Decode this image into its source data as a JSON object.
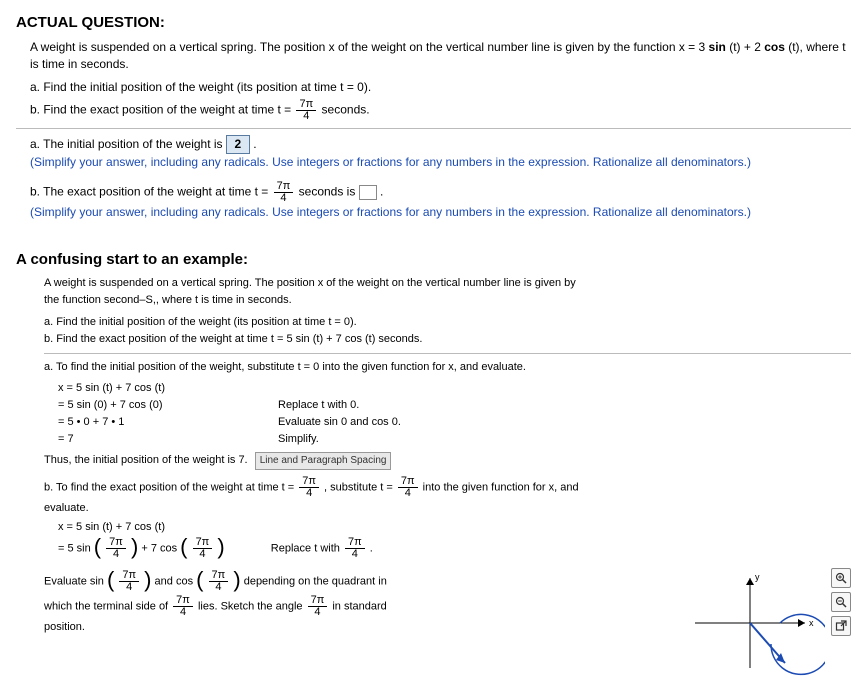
{
  "titles": {
    "actual": "ACTUAL QUESTION:",
    "example": "A confusing start to an example:"
  },
  "problem": {
    "statement_prefix": "A weight is suspended on a vertical spring. The position x of the weight on the vertical number line is given by the function x = 3 ",
    "func_sin": "sin",
    "func_cos": "cos",
    "statement_mid": " (t) + 2 ",
    "statement_suffix": " (t), where t is time in seconds.",
    "part_a": "a. Find the initial position of the weight (its position at time t = 0).",
    "part_b_prefix": "b. Find the exact position of the weight at time t = ",
    "part_b_suffix": " seconds.",
    "frac_num": "7π",
    "frac_den": "4"
  },
  "answers": {
    "a_prefix": "a. The initial position of the weight is ",
    "a_value": "2",
    "a_period": ".",
    "hint_text": "(Simplify your answer, including any radicals. Use integers or fractions for any numbers in the expression. Rationalize all denominators.)",
    "b_prefix": "b. The exact position of the weight at time t = ",
    "b_mid": " seconds is ",
    "b_period": "."
  },
  "example": {
    "statement1": "A weight is suspended on a vertical spring. The position x of the weight on the vertical number line is given by",
    "statement2": "the function second–S,, where t is time in seconds.",
    "part_a": "a. Find the initial position of the weight (its position at time t = 0).",
    "part_b": "b. Find the exact position of the weight at time t = 5 sin (t) + 7 cos (t) seconds.",
    "step_a_intro": "a. To find the initial position of the weight, substitute t = 0 into the given function for x, and evaluate.",
    "lines": {
      "l1_left": "x = 5 sin (t) + 7 cos (t)",
      "l2_left": "= 5 sin (0) + 7 cos (0)",
      "l2_right": "Replace t with 0.",
      "l3_left": "= 5 • 0 + 7 • 1",
      "l3_right": "Evaluate sin 0 and cos 0.",
      "l4_left": "= 7",
      "l4_right": "Simplify."
    },
    "thus": "Thus, the initial position of the weight is 7.",
    "tooltip": "Line and Paragraph Spacing",
    "b_intro_prefix": "b. To find the exact position of the weight at time t = ",
    "b_intro_mid": ", substitute t = ",
    "b_intro_suffix": " into the given function for x, and",
    "evaluate": "evaluate.",
    "line_x": "x = 5 sin (t) + 7 cos (t)",
    "line_sub_prefix_a": "= 5 sin ",
    "line_sub_mid": " + 7 cos ",
    "replace_prefix": "Replace t with ",
    "replace_suffix": ".",
    "eval_prefix": "Evaluate sin ",
    "eval_mid": " and cos ",
    "eval_suffix": " depending on the quadrant in",
    "which_prefix": "which the terminal side of ",
    "which_mid": " lies. Sketch the angle ",
    "which_suffix": " in standard",
    "position": "position."
  },
  "icons": {
    "zoom_in": "zoom-in",
    "zoom_out": "zoom-out",
    "popout": "popout"
  }
}
